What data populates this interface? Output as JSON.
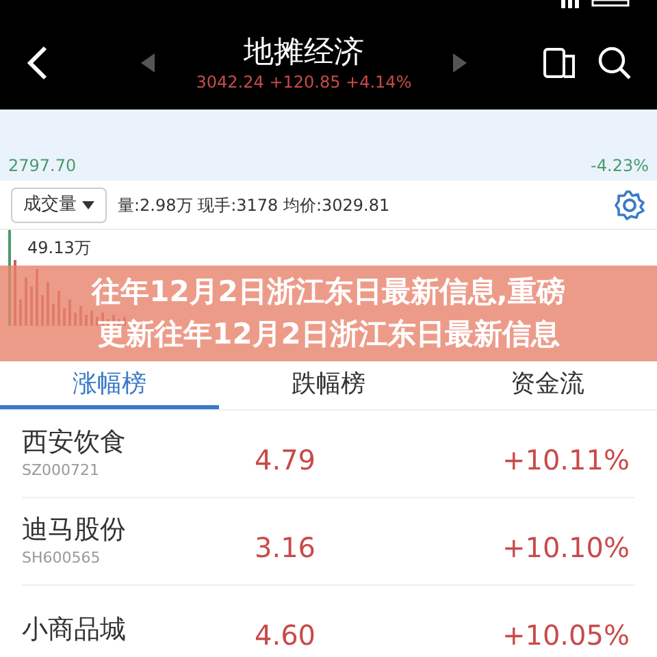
{
  "header": {
    "title": "地摊经济",
    "quote": "3042.24 +120.85 +4.14%"
  },
  "price_chart": {
    "low": "2797.70",
    "low_pct": "-4.23%"
  },
  "volume_bar": {
    "dropdown": "成交量",
    "stats": "量:2.98万 现手:3178 均价:3029.81",
    "max_label": "49.13万"
  },
  "banner": {
    "title": "往年12月2日浙江东日最新信息,重磅更新往年12月2日浙江东日最新信息"
  },
  "tabs": [
    {
      "label": "涨幅榜",
      "selected": true
    },
    {
      "label": "跌幅榜",
      "selected": false
    },
    {
      "label": "资金流",
      "selected": false
    }
  ],
  "stocks": [
    {
      "name": "西安饮食",
      "code": "SZ000721",
      "price": "4.79",
      "change": "+10.11%"
    },
    {
      "name": "迪马股份",
      "code": "SH600565",
      "price": "3.16",
      "change": "+10.10%"
    },
    {
      "name": "小商品城",
      "price": "4.60",
      "change": "+10.05%"
    }
  ]
}
